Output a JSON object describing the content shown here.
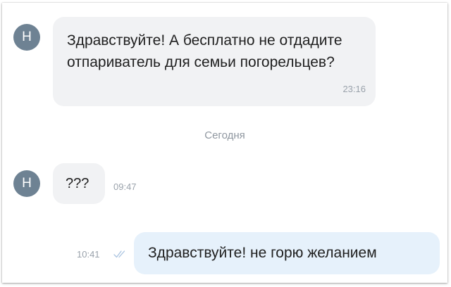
{
  "colors": {
    "avatar_bg": "#6e8293",
    "incoming_bubble": "#f1f2f4",
    "outgoing_bubble": "#e6f1fb",
    "timestamp": "#9aa2ab",
    "read_check": "#a9c3e0"
  },
  "contact": {
    "avatar_letter": "Н"
  },
  "messages": [
    {
      "direction": "incoming",
      "text": "Здравствуйте! А бесплатно не отдадите отпариватель для семьи погорельцев?",
      "time": "23:16"
    },
    {
      "direction": "incoming",
      "text": "???",
      "time": "09:47"
    },
    {
      "direction": "outgoing",
      "text": "Здравствуйте! не горю желанием",
      "time": "10:41",
      "status_icon": "double-check-icon"
    }
  ],
  "date_separator": "Сегодня"
}
